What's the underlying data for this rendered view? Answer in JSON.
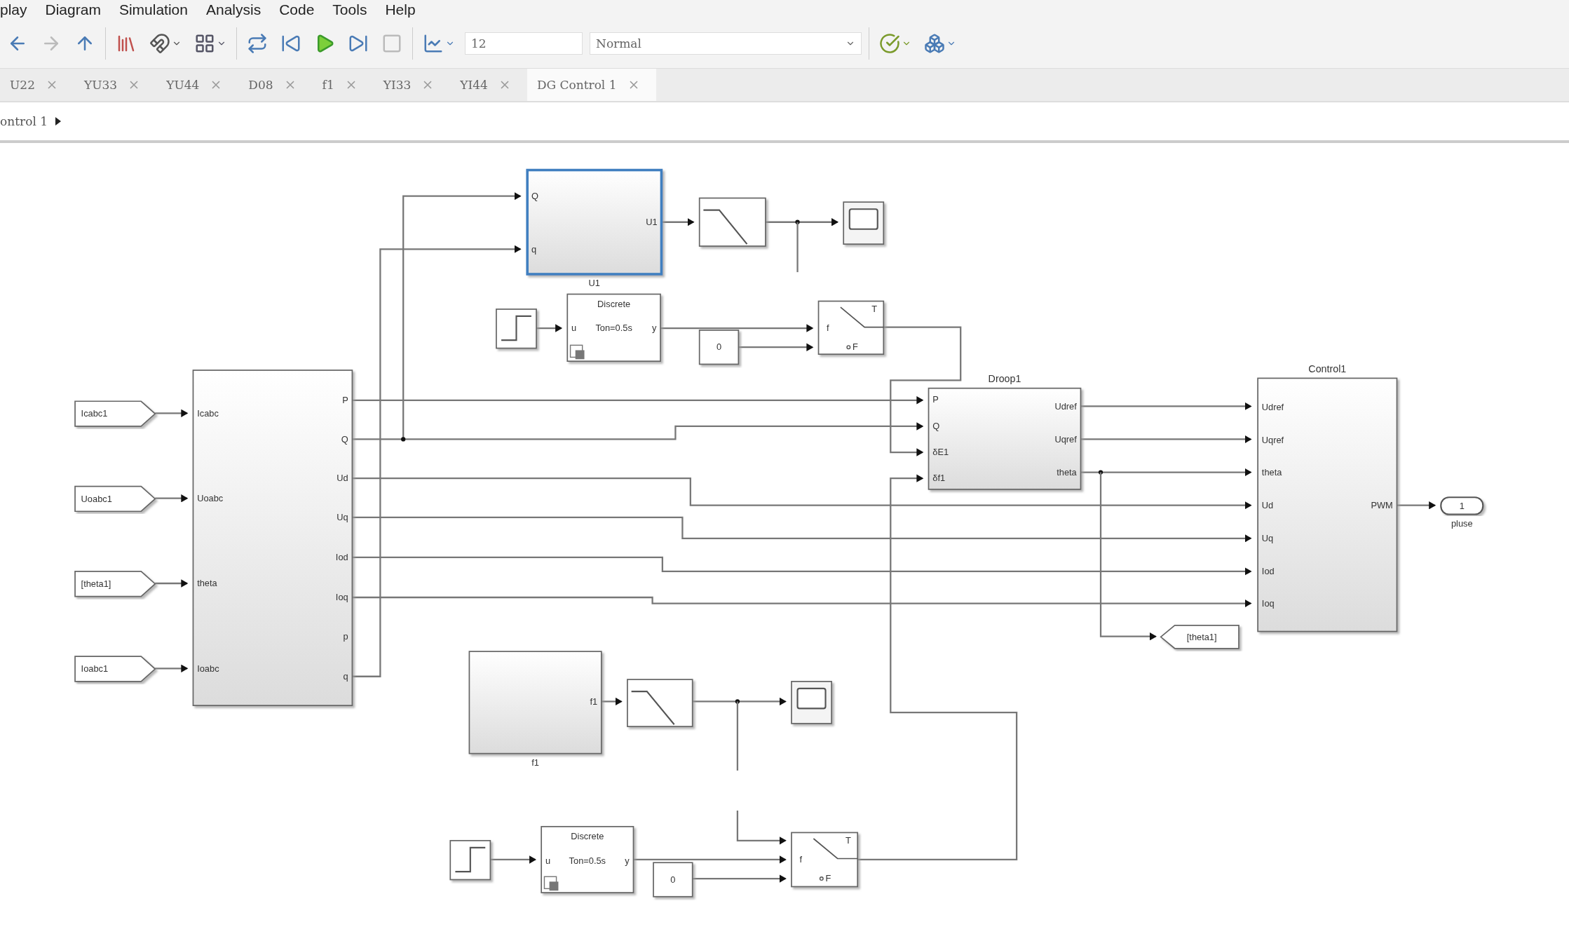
{
  "menu": [
    "play",
    "Diagram",
    "Simulation",
    "Analysis",
    "Code",
    "Tools",
    "Help"
  ],
  "toolbar": {
    "stop_time": "12",
    "mode": "Normal"
  },
  "tabs": [
    {
      "label": "U22",
      "selected": false
    },
    {
      "label": "YU33",
      "selected": false
    },
    {
      "label": "YU44",
      "selected": false
    },
    {
      "label": "D08",
      "selected": false
    },
    {
      "label": "f1",
      "selected": false
    },
    {
      "label": "YI33",
      "selected": false
    },
    {
      "label": "YI44",
      "selected": false
    },
    {
      "label": "DG Control 1",
      "selected": true
    }
  ],
  "breadcrumb": "ontrol 1",
  "diagram": {
    "blocks": [
      {
        "kind": "subsystem",
        "selected": true,
        "name": "U1",
        "inputs": [
          "Q",
          "q"
        ],
        "outputs": [
          "U1"
        ]
      },
      {
        "kind": "transfer",
        "selected": false
      },
      {
        "kind": "scope",
        "selected": false
      },
      {
        "kind": "step",
        "selected": false
      },
      {
        "kind": "generator",
        "selected": false,
        "lines": [
          "Discrete",
          "Ton=0.5s"
        ],
        "inputs": [
          "u"
        ],
        "outputs": [
          "y"
        ]
      },
      {
        "kind": "constant",
        "selected": false,
        "value": "0"
      },
      {
        "kind": "switch",
        "selected": false,
        "labels": [
          "T",
          "f",
          "F"
        ]
      },
      {
        "kind": "from",
        "selected": false,
        "label": "Icabc1"
      },
      {
        "kind": "from",
        "selected": false,
        "label": "Uoabc1"
      },
      {
        "kind": "from",
        "selected": false,
        "label": "[theta1]"
      },
      {
        "kind": "from",
        "selected": false,
        "label": "Ioabc1"
      },
      {
        "kind": "subsystem",
        "selected": false,
        "inputs": [
          "Icabc",
          "Uoabc",
          "theta",
          "Ioabc"
        ],
        "outputs": [
          "P",
          "Q",
          "Ud",
          "Uq",
          "Iod",
          "Ioq",
          "p",
          "q"
        ]
      },
      {
        "kind": "subsystem",
        "selected": false,
        "title": "Droop1",
        "inputs": [
          "P",
          "Q",
          "δE1",
          "δf1"
        ],
        "outputs": [
          "Udref",
          "Uqref",
          "theta"
        ]
      },
      {
        "kind": "subsystem",
        "selected": false,
        "title": "Control1",
        "inputs": [
          "Udref",
          "Uqref",
          "theta",
          "Ud",
          "Uq",
          "Iod",
          "Ioq"
        ],
        "outputs": [
          "PWM"
        ]
      },
      {
        "kind": "outport",
        "selected": false,
        "value": "1",
        "name": "pluse"
      },
      {
        "kind": "goto",
        "selected": false,
        "label": "[theta1]"
      },
      {
        "kind": "subsystem",
        "selected": false,
        "name": "f1",
        "outputs": [
          "f1"
        ]
      },
      {
        "kind": "transfer",
        "selected": false
      },
      {
        "kind": "scope",
        "selected": false
      },
      {
        "kind": "step",
        "selected": false
      },
      {
        "kind": "generator",
        "selected": false,
        "lines": [
          "Discrete",
          "Ton=0.5s"
        ],
        "inputs": [
          "u"
        ],
        "outputs": [
          "y"
        ]
      },
      {
        "kind": "constant",
        "selected": false,
        "value": "0"
      },
      {
        "kind": "switch",
        "selected": false,
        "labels": [
          "T",
          "f",
          "F"
        ]
      }
    ]
  }
}
